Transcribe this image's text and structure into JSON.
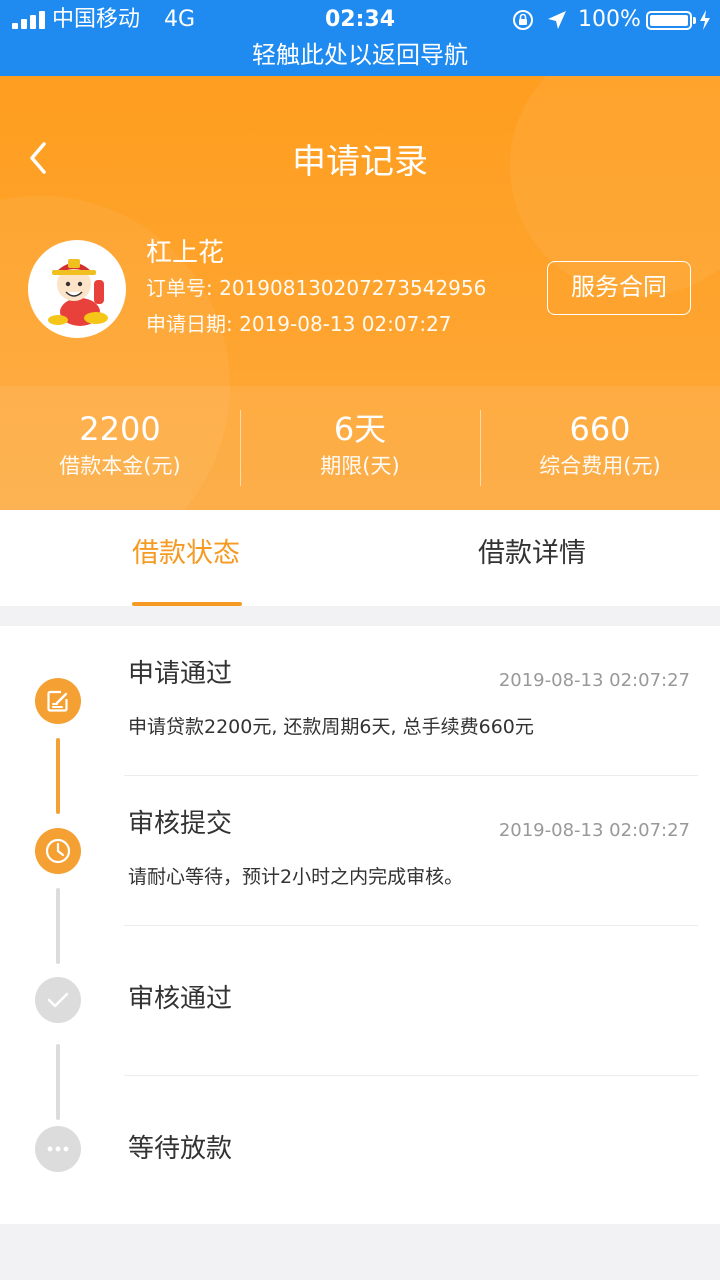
{
  "status_bar": {
    "carrier": "中国移动",
    "network": "4G",
    "time": "02:34",
    "battery": "100%",
    "battery_level": 1.0,
    "signal_bars": 4
  },
  "return_banner": "轻触此处以返回导航",
  "header": {
    "title": "申请记录",
    "user_name": "杠上花",
    "order_label": "订单号: ",
    "order_no": "20190813020727354​2956",
    "date_label": "申请日期: ",
    "date": "2019-08-13 02:07:27",
    "contract_button": "服务合同"
  },
  "stats": [
    {
      "value": "2200",
      "label": "借款本金(元)"
    },
    {
      "value": "6天",
      "label": "期限(天)"
    },
    {
      "value": "660",
      "label": "综合费用(元)"
    }
  ],
  "tabs": {
    "active": "借款状态",
    "inactive": "借款详情"
  },
  "timeline": [
    {
      "title": "申请通过",
      "time": "2019-08-13 02:07:27",
      "desc": "申请贷款2200元, 还款周期6天, 总手续费660元",
      "state": "done",
      "icon": "edit-icon"
    },
    {
      "title": "审核提交",
      "time": "2019-08-13 02:07:27",
      "desc": "请耐心等待，预计2小时之内完成审核。",
      "state": "current",
      "icon": "clock-icon"
    },
    {
      "title": "审核通过",
      "time": "",
      "desc": "",
      "state": "pending",
      "icon": "check-icon"
    },
    {
      "title": "等待放款",
      "time": "",
      "desc": "",
      "state": "pending",
      "icon": "more-icon"
    }
  ],
  "colors": {
    "status_blue": "#1f8bf0",
    "header_orange": "#ff9e1f",
    "accent": "#f59a23",
    "inactive_gray": "#dcdcdc"
  }
}
